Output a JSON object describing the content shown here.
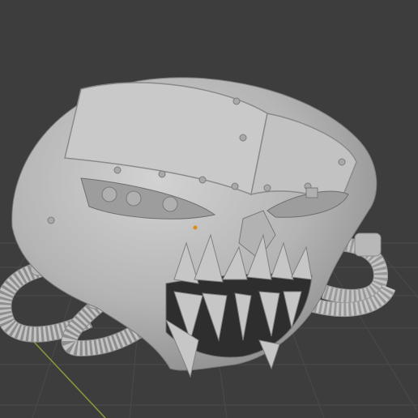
{
  "viewport": {
    "background": "#3d3d3d",
    "grid_color": "#4a4a4a",
    "x_axis_color": "#8a9a3a",
    "model_color": "#bdbdbd",
    "origin_color": "#e08a1a"
  },
  "model": {
    "name": "sculpted-helmet-with-hoses",
    "icon": "3d-mesh"
  }
}
